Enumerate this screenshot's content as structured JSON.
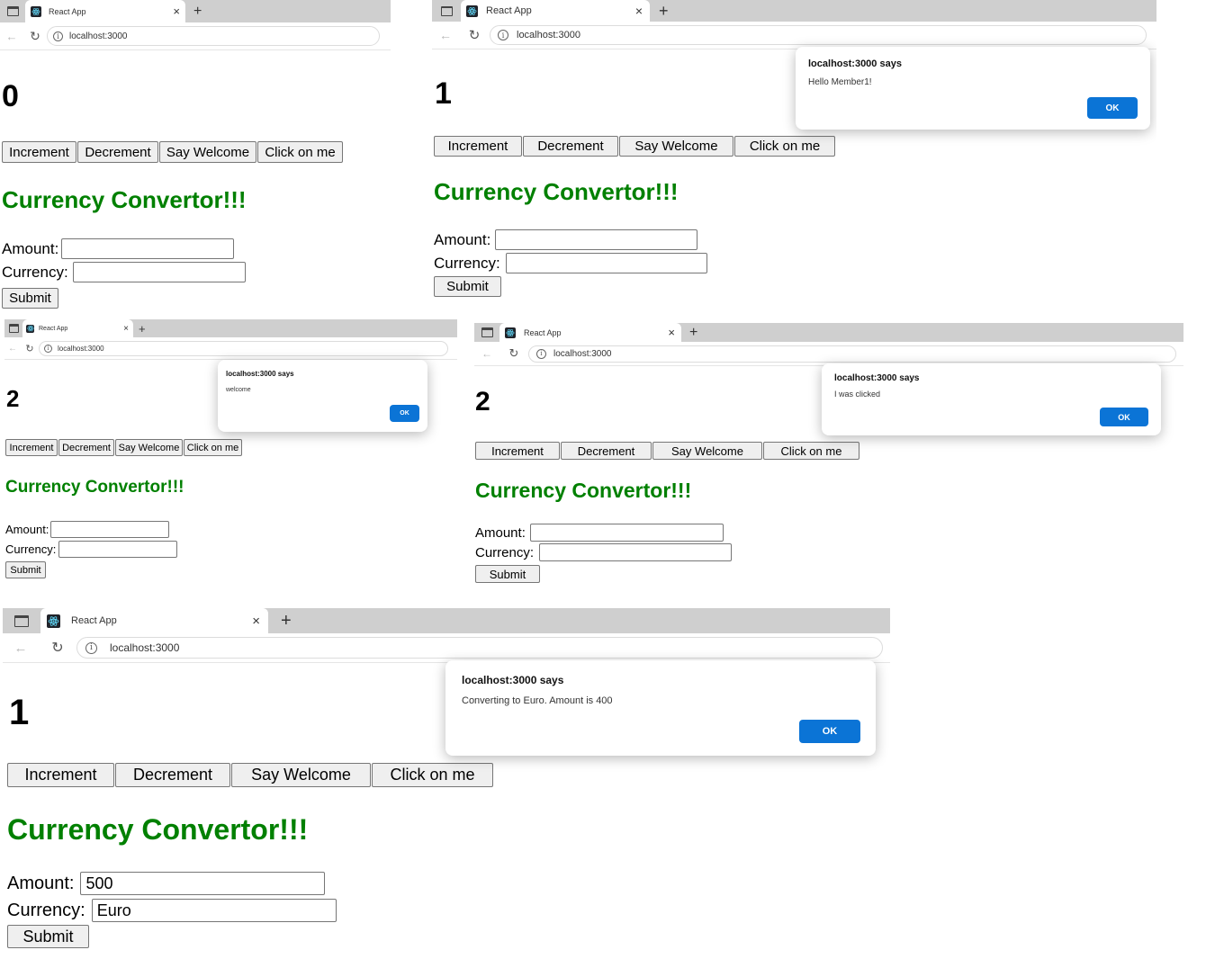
{
  "browser": {
    "tab_title": "React App",
    "url": "localhost:3000",
    "close_glyph": "×",
    "new_tab_glyph": "+",
    "back_glyph": "←",
    "reload_glyph": "↻",
    "info_glyph": "i"
  },
  "buttons": {
    "increment": "Increment",
    "decrement": "Decrement",
    "say_welcome": "Say Welcome",
    "click_on_me": "Click on me"
  },
  "converter": {
    "heading": "Currency Convertor!!!",
    "amount_label": "Amount:",
    "currency_label": "Currency:",
    "submit_label": "Submit"
  },
  "dialog_common": {
    "ok_label": "OK"
  },
  "screens": [
    {
      "count": "0",
      "amount_value": "",
      "currency_value": ""
    },
    {
      "count": "1",
      "amount_value": "",
      "currency_value": "",
      "dialog": {
        "title": "localhost:3000 says",
        "message": "Hello Member1!"
      }
    },
    {
      "count": "2",
      "amount_value": "",
      "currency_value": "",
      "dialog": {
        "title": "localhost:3000 says",
        "message": "welcome"
      }
    },
    {
      "count": "2",
      "amount_value": "",
      "currency_value": "",
      "dialog": {
        "title": "localhost:3000 says",
        "message": "I was clicked"
      }
    },
    {
      "count": "1",
      "amount_value": "500",
      "currency_value": "Euro",
      "dialog": {
        "title": "localhost:3000 says",
        "message": "Converting to Euro. Amount is 400"
      }
    }
  ],
  "colors": {
    "heading_green": "#008000",
    "ok_blue": "#0b74d6",
    "tab_strip": "#cfcfcf"
  },
  "icons": [
    "window-icon",
    "react-favicon-icon",
    "close-icon",
    "new-tab-icon",
    "back-icon",
    "reload-icon",
    "info-icon"
  ]
}
